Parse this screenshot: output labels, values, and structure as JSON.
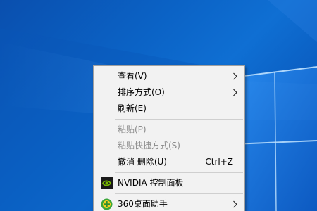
{
  "colors": {
    "desktop_blue": "#0b63c6",
    "menu_bg": "#f2f2f2",
    "disabled_text": "#8a8a8a",
    "nvidia_green": "#76b900",
    "icon_360_green": "#3aa63a"
  },
  "context_menu": {
    "view": {
      "label": "查看(V)",
      "has_submenu": true
    },
    "sort_by": {
      "label": "排序方式(O)",
      "has_submenu": true
    },
    "refresh": {
      "label": "刷新(E)"
    },
    "paste": {
      "label": "粘贴(P)",
      "disabled": true
    },
    "paste_shortcut": {
      "label": "粘贴快捷方式(S)",
      "disabled": true
    },
    "undo_delete": {
      "label": "撤消 删除(U)",
      "shortcut": "Ctrl+Z"
    },
    "nvidia": {
      "label": "NVIDIA 控制面板",
      "icon": "nvidia-icon"
    },
    "desktop_helper": {
      "label": "360桌面助手",
      "icon": "360-icon",
      "has_submenu": true
    }
  }
}
